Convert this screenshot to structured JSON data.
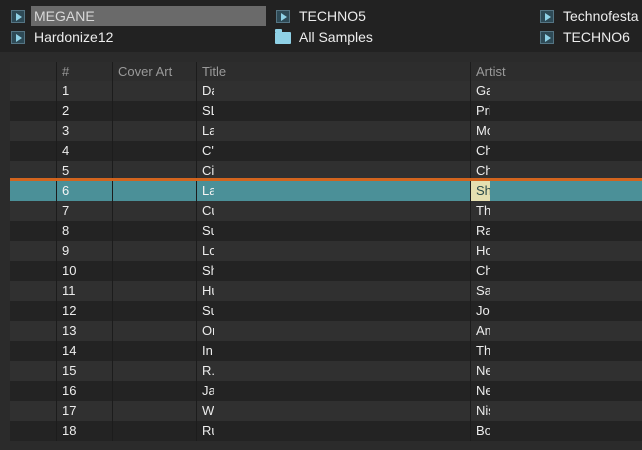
{
  "favorites": [
    {
      "label": "MEGANE",
      "icon": "playlist-icon",
      "selected": true
    },
    {
      "label": "TECHNO5",
      "icon": "playlist-icon",
      "selected": false
    },
    {
      "label": "Technofesta",
      "icon": "playlist-icon",
      "selected": false
    },
    {
      "label": "Hardonize12",
      "icon": "playlist-icon",
      "selected": false
    },
    {
      "label": "All Samples",
      "icon": "folder-icon",
      "selected": false
    },
    {
      "label": "TECHNO6",
      "icon": "playlist-icon",
      "selected": false
    }
  ],
  "columns": {
    "number": "#",
    "cover_art": "Cover Art",
    "title": "Title",
    "artist": "Artist"
  },
  "tracks": [
    {
      "n": "1",
      "title": "Da",
      "artist": "Ga"
    },
    {
      "n": "2",
      "title": "SL'",
      "artist": "Pri"
    },
    {
      "n": "3",
      "title": "Lat",
      "artist": "Mo"
    },
    {
      "n": "4",
      "title": "C'r",
      "artist": "Ch"
    },
    {
      "n": "5",
      "title": "Cit",
      "artist": "Ch"
    },
    {
      "n": "6",
      "title": "Lat",
      "artist": "Sh"
    },
    {
      "n": "7",
      "title": "Cu",
      "artist": "Th"
    },
    {
      "n": "8",
      "title": "Su",
      "artist": "Ra"
    },
    {
      "n": "9",
      "title": "Lov",
      "artist": "Ho"
    },
    {
      "n": "10",
      "title": "Sh",
      "artist": "Ch"
    },
    {
      "n": "11",
      "title": "Hu",
      "artist": "Sa"
    },
    {
      "n": "12",
      "title": "Su",
      "artist": "Jo"
    },
    {
      "n": "13",
      "title": "On",
      "artist": "Am"
    },
    {
      "n": "14",
      "title": "In I",
      "artist": "Th"
    },
    {
      "n": "15",
      "title": "R.A",
      "artist": "Ne"
    },
    {
      "n": "16",
      "title": "Jac",
      "artist": "Ne"
    },
    {
      "n": "17",
      "title": "Wh",
      "artist": "Nis"
    },
    {
      "n": "18",
      "title": "Ru",
      "artist": "Bo"
    }
  ],
  "selected_track": "6",
  "colors": {
    "selection": "#4b9098",
    "accent": "#d2641e",
    "folder": "#8fd1e6"
  }
}
